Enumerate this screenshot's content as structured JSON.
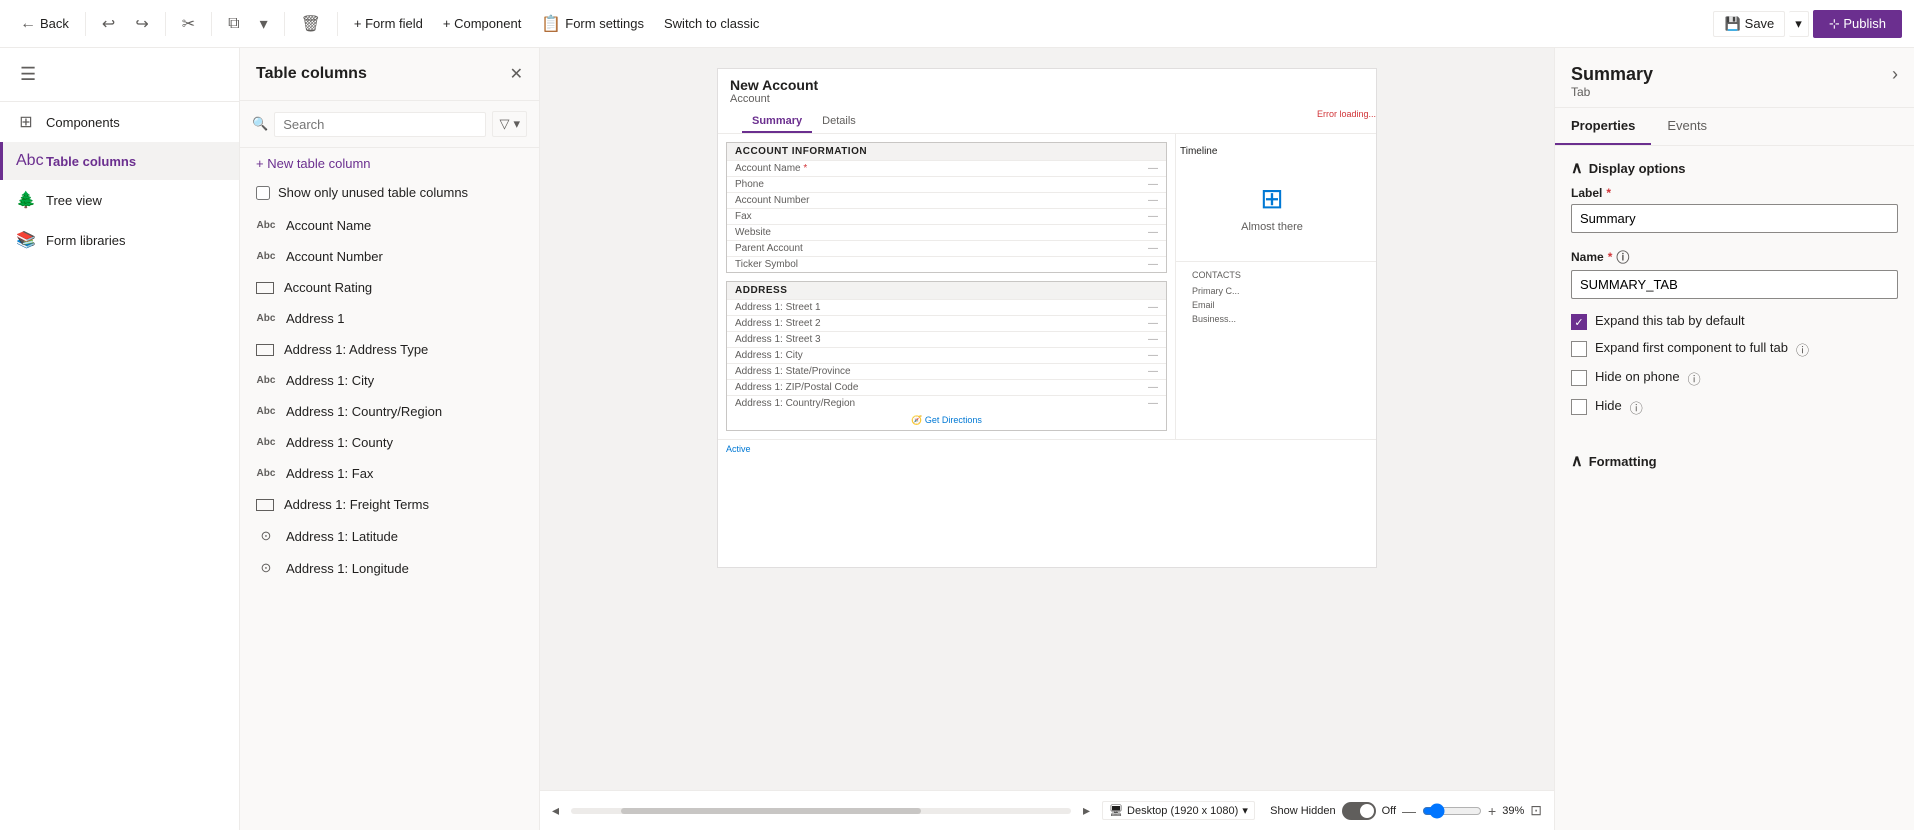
{
  "toolbar": {
    "back_label": "Back",
    "undo_icon": "↩",
    "redo_icon": "↪",
    "cut_icon": "✂",
    "paste_icon": "⧉",
    "dropdown_icon": "▾",
    "delete_icon": "🗑",
    "form_field_label": "+ Form field",
    "component_label": "+ Component",
    "form_settings_label": "Form settings",
    "switch_classic_label": "Switch to classic",
    "save_label": "Save",
    "save_dropdown_icon": "▾",
    "publish_label": "Publish"
  },
  "left_sidebar": {
    "hamburger": "☰",
    "items": [
      {
        "id": "components",
        "label": "Components",
        "icon": "⊞"
      },
      {
        "id": "table-columns",
        "label": "Table columns",
        "icon": "Abc",
        "active": true
      },
      {
        "id": "tree-view",
        "label": "Tree view",
        "icon": "🌲"
      },
      {
        "id": "form-libraries",
        "label": "Form libraries",
        "icon": "📚"
      }
    ]
  },
  "table_columns_panel": {
    "title": "Table columns",
    "close_icon": "✕",
    "search_placeholder": "Search",
    "filter_icon": "▽",
    "dropdown_icon": "▾",
    "add_column_label": "+ New table column",
    "show_unused_label": "Show only unused table columns",
    "columns": [
      {
        "id": "account-name",
        "label": "Account Name",
        "icon": "Abc"
      },
      {
        "id": "account-number",
        "label": "Account Number",
        "icon": "Abc"
      },
      {
        "id": "account-rating",
        "label": "Account Rating",
        "icon": "▭"
      },
      {
        "id": "address-1",
        "label": "Address 1",
        "icon": "Abc"
      },
      {
        "id": "address-type",
        "label": "Address 1: Address Type",
        "icon": "▭"
      },
      {
        "id": "address-city",
        "label": "Address 1: City",
        "icon": "Abc"
      },
      {
        "id": "address-country",
        "label": "Address 1: Country/Region",
        "icon": "Abc"
      },
      {
        "id": "address-county",
        "label": "Address 1: County",
        "icon": "Abc"
      },
      {
        "id": "address-fax",
        "label": "Address 1: Fax",
        "icon": "Abc"
      },
      {
        "id": "address-freight",
        "label": "Address 1: Freight Terms",
        "icon": "▭"
      },
      {
        "id": "address-latitude",
        "label": "Address 1: Latitude",
        "icon": "⊙"
      },
      {
        "id": "address-longitude",
        "label": "Address 1: Longitude",
        "icon": "⊙"
      }
    ]
  },
  "form_preview": {
    "title": "New Account",
    "subtitle": "Account",
    "tabs": [
      "Summary",
      "Details"
    ],
    "active_tab": "Summary",
    "sections": {
      "account_info": {
        "header": "ACCOUNT INFORMATION",
        "fields": [
          {
            "label": "Account Name",
            "required": true,
            "value": "—"
          },
          {
            "label": "Phone",
            "value": "—"
          },
          {
            "label": "Account Number",
            "value": "—"
          },
          {
            "label": "Fax",
            "value": "—"
          },
          {
            "label": "Website",
            "value": "—"
          },
          {
            "label": "Parent Account",
            "value": "—"
          },
          {
            "label": "Ticker Symbol",
            "value": "—"
          }
        ]
      },
      "address": {
        "header": "ADDRESS",
        "fields": [
          {
            "label": "Address 1: Street 1",
            "value": "—"
          },
          {
            "label": "Address 1: Street 2",
            "value": "—"
          },
          {
            "label": "Address 1: Street 3",
            "value": "—"
          },
          {
            "label": "Address 1: City",
            "value": "—"
          },
          {
            "label": "Address 1: State/Province",
            "value": "—"
          },
          {
            "label": "Address 1: ZIP/Postal Code",
            "value": "—"
          },
          {
            "label": "Address 1: Country/Region",
            "value": "—"
          }
        ]
      }
    },
    "timeline_label": "Timeline",
    "almost_there_label": "Almost there",
    "error_loading": "Error loading...",
    "contacts_label": "CONTACTS",
    "primary_contact_label": "Primary C...",
    "email_label": "Email",
    "business_label": "Business...",
    "get_directions_label": "🧭 Get Directions",
    "status_label": "Active"
  },
  "canvas_bottom": {
    "device_label": "Desktop (1920 x 1080)",
    "show_hidden_label": "Show Hidden",
    "toggle_state": "Off",
    "zoom_minus": "—",
    "zoom_plus": "+",
    "zoom_value": "39%",
    "fit_icon": "⊡"
  },
  "right_panel": {
    "title": "Summary",
    "subtitle": "Tab",
    "nav_icon": "›",
    "tabs": [
      "Properties",
      "Events"
    ],
    "active_tab": "Properties",
    "display_options": {
      "section_label": "Display options",
      "label_field": {
        "label": "Label",
        "value": "Summary",
        "required": true
      },
      "name_field": {
        "label": "Name",
        "value": "SUMMARY_TAB",
        "required": true
      },
      "checkboxes": [
        {
          "id": "expand-default",
          "label": "Expand this tab by default",
          "checked": true,
          "info": true
        },
        {
          "id": "expand-full",
          "label": "Expand first component to full tab",
          "checked": false,
          "info": true
        },
        {
          "id": "hide-phone",
          "label": "Hide on phone",
          "checked": false,
          "info": true
        },
        {
          "id": "hide",
          "label": "Hide",
          "checked": false,
          "info": true
        }
      ]
    },
    "formatting": {
      "section_label": "Formatting"
    }
  }
}
